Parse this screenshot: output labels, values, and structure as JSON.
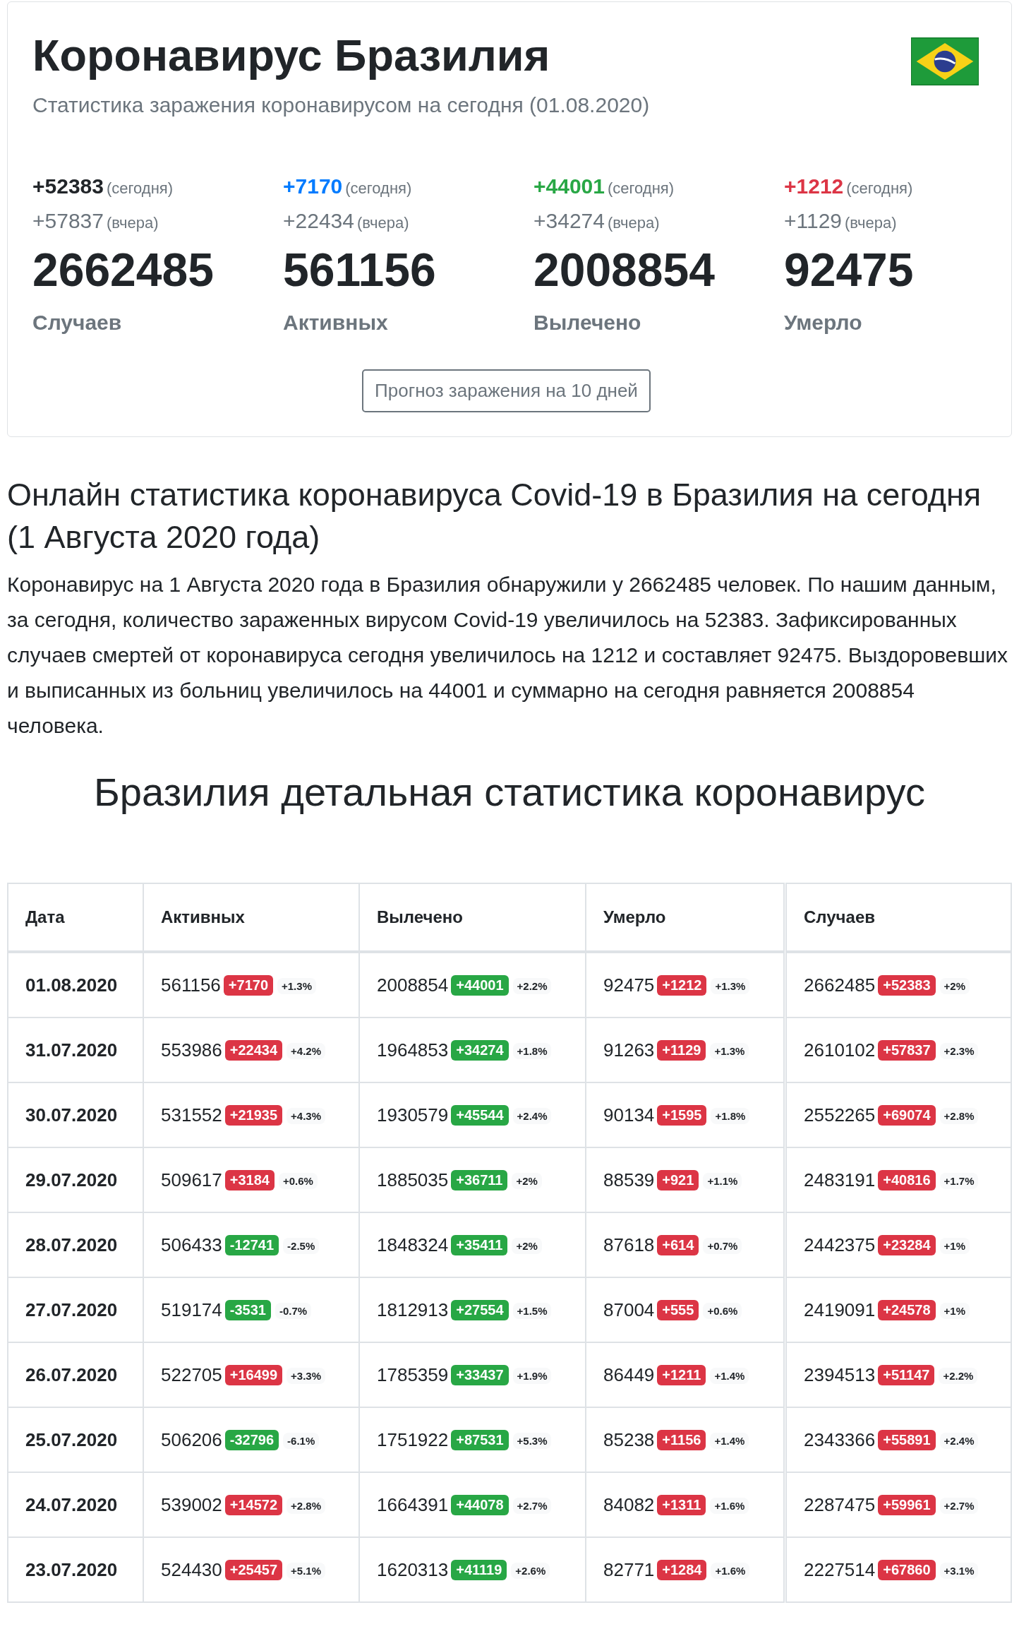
{
  "header": {
    "title": "Коронавирус Бразилия",
    "subtitle": "Статистика заражения коронавирусом на сегодня (01.08.2020)"
  },
  "stats": [
    {
      "today": "+52383",
      "today_label": "(сегодня)",
      "color": "#212529",
      "yesterday": "+57837",
      "yesterday_label": "(вчера)",
      "total": "2662485",
      "label": "Случаев"
    },
    {
      "today": "+7170",
      "today_label": "(сегодня)",
      "color": "#007bff",
      "yesterday": "+22434",
      "yesterday_label": "(вчера)",
      "total": "561156",
      "label": "Активных"
    },
    {
      "today": "+44001",
      "today_label": "(сегодня)",
      "color": "#28a745",
      "yesterday": "+34274",
      "yesterday_label": "(вчера)",
      "total": "2008854",
      "label": "Вылечено"
    },
    {
      "today": "+1212",
      "today_label": "(сегодня)",
      "color": "#dc3545",
      "yesterday": "+1129",
      "yesterday_label": "(вчера)",
      "total": "92475",
      "label": "Умерло"
    }
  ],
  "forecast_button": "Прогноз заражения на 10 дней",
  "article": {
    "heading": "Онлайн статистика коронавируса Covid-19 в Бразилия на сегодня (1 Августа 2020 года)",
    "paragraph": "Коронавирус на 1 Августа 2020 года в Бразилия обнаружили у 2662485 человек. По нашим данным, за сегодня, количество зараженных вирусом Covid-19 увеличилось на 52383. Зафиксированных случаев смертей от коронавируса сегодня увеличилось на 1212 и составляет 92475. Выздоровевших и выписанных из больниц увеличилось на 44001 и суммарно на сегодня равняется 2008854 человека."
  },
  "detail_heading": "Бразилия детальная статистика коронавирус",
  "table": {
    "columns": [
      "Дата",
      "Активных",
      "Вылечено",
      "Умерло",
      "Случаев"
    ],
    "rows": [
      {
        "cells": [
          {
            "kind": "date",
            "value": "01.08.2020"
          },
          {
            "kind": "stat",
            "value": "561156",
            "change": "+7170",
            "color": "#dc3545",
            "pct": "+1.3%"
          },
          {
            "kind": "stat",
            "value": "2008854",
            "change": "+44001",
            "color": "#28a745",
            "pct": "+2.2%"
          },
          {
            "kind": "stat",
            "value": "92475",
            "change": "+1212",
            "color": "#dc3545",
            "pct": "+1.3%"
          },
          {
            "kind": "stat",
            "value": "2662485",
            "change": "+52383",
            "color": "#dc3545",
            "pct": "+2%"
          }
        ]
      },
      {
        "cells": [
          {
            "kind": "date",
            "value": "31.07.2020"
          },
          {
            "kind": "stat",
            "value": "553986",
            "change": "+22434",
            "color": "#dc3545",
            "pct": "+4.2%"
          },
          {
            "kind": "stat",
            "value": "1964853",
            "change": "+34274",
            "color": "#28a745",
            "pct": "+1.8%"
          },
          {
            "kind": "stat",
            "value": "91263",
            "change": "+1129",
            "color": "#dc3545",
            "pct": "+1.3%"
          },
          {
            "kind": "stat",
            "value": "2610102",
            "change": "+57837",
            "color": "#dc3545",
            "pct": "+2.3%"
          }
        ]
      },
      {
        "cells": [
          {
            "kind": "date",
            "value": "30.07.2020"
          },
          {
            "kind": "stat",
            "value": "531552",
            "change": "+21935",
            "color": "#dc3545",
            "pct": "+4.3%"
          },
          {
            "kind": "stat",
            "value": "1930579",
            "change": "+45544",
            "color": "#28a745",
            "pct": "+2.4%"
          },
          {
            "kind": "stat",
            "value": "90134",
            "change": "+1595",
            "color": "#dc3545",
            "pct": "+1.8%"
          },
          {
            "kind": "stat",
            "value": "2552265",
            "change": "+69074",
            "color": "#dc3545",
            "pct": "+2.8%"
          }
        ]
      },
      {
        "cells": [
          {
            "kind": "date",
            "value": "29.07.2020"
          },
          {
            "kind": "stat",
            "value": "509617",
            "change": "+3184",
            "color": "#dc3545",
            "pct": "+0.6%"
          },
          {
            "kind": "stat",
            "value": "1885035",
            "change": "+36711",
            "color": "#28a745",
            "pct": "+2%"
          },
          {
            "kind": "stat",
            "value": "88539",
            "change": "+921",
            "color": "#dc3545",
            "pct": "+1.1%"
          },
          {
            "kind": "stat",
            "value": "2483191",
            "change": "+40816",
            "color": "#dc3545",
            "pct": "+1.7%"
          }
        ]
      },
      {
        "cells": [
          {
            "kind": "date",
            "value": "28.07.2020"
          },
          {
            "kind": "stat",
            "value": "506433",
            "change": "-12741",
            "color": "#28a745",
            "pct": "-2.5%"
          },
          {
            "kind": "stat",
            "value": "1848324",
            "change": "+35411",
            "color": "#28a745",
            "pct": "+2%"
          },
          {
            "kind": "stat",
            "value": "87618",
            "change": "+614",
            "color": "#dc3545",
            "pct": "+0.7%"
          },
          {
            "kind": "stat",
            "value": "2442375",
            "change": "+23284",
            "color": "#dc3545",
            "pct": "+1%"
          }
        ]
      },
      {
        "cells": [
          {
            "kind": "date",
            "value": "27.07.2020"
          },
          {
            "kind": "stat",
            "value": "519174",
            "change": "-3531",
            "color": "#28a745",
            "pct": "-0.7%"
          },
          {
            "kind": "stat",
            "value": "1812913",
            "change": "+27554",
            "color": "#28a745",
            "pct": "+1.5%"
          },
          {
            "kind": "stat",
            "value": "87004",
            "change": "+555",
            "color": "#dc3545",
            "pct": "+0.6%"
          },
          {
            "kind": "stat",
            "value": "2419091",
            "change": "+24578",
            "color": "#dc3545",
            "pct": "+1%"
          }
        ]
      },
      {
        "cells": [
          {
            "kind": "date",
            "value": "26.07.2020"
          },
          {
            "kind": "stat",
            "value": "522705",
            "change": "+16499",
            "color": "#dc3545",
            "pct": "+3.3%"
          },
          {
            "kind": "stat",
            "value": "1785359",
            "change": "+33437",
            "color": "#28a745",
            "pct": "+1.9%"
          },
          {
            "kind": "stat",
            "value": "86449",
            "change": "+1211",
            "color": "#dc3545",
            "pct": "+1.4%"
          },
          {
            "kind": "stat",
            "value": "2394513",
            "change": "+51147",
            "color": "#dc3545",
            "pct": "+2.2%"
          }
        ]
      },
      {
        "cells": [
          {
            "kind": "date",
            "value": "25.07.2020"
          },
          {
            "kind": "stat",
            "value": "506206",
            "change": "-32796",
            "color": "#28a745",
            "pct": "-6.1%"
          },
          {
            "kind": "stat",
            "value": "1751922",
            "change": "+87531",
            "color": "#28a745",
            "pct": "+5.3%"
          },
          {
            "kind": "stat",
            "value": "85238",
            "change": "+1156",
            "color": "#dc3545",
            "pct": "+1.4%"
          },
          {
            "kind": "stat",
            "value": "2343366",
            "change": "+55891",
            "color": "#dc3545",
            "pct": "+2.4%"
          }
        ]
      },
      {
        "cells": [
          {
            "kind": "date",
            "value": "24.07.2020"
          },
          {
            "kind": "stat",
            "value": "539002",
            "change": "+14572",
            "color": "#dc3545",
            "pct": "+2.8%"
          },
          {
            "kind": "stat",
            "value": "1664391",
            "change": "+44078",
            "color": "#28a745",
            "pct": "+2.7%"
          },
          {
            "kind": "stat",
            "value": "84082",
            "change": "+1311",
            "color": "#dc3545",
            "pct": "+1.6%"
          },
          {
            "kind": "stat",
            "value": "2287475",
            "change": "+59961",
            "color": "#dc3545",
            "pct": "+2.7%"
          }
        ]
      },
      {
        "cells": [
          {
            "kind": "date",
            "value": "23.07.2020"
          },
          {
            "kind": "stat",
            "value": "524430",
            "change": "+25457",
            "color": "#dc3545",
            "pct": "+5.1%"
          },
          {
            "kind": "stat",
            "value": "1620313",
            "change": "+41119",
            "color": "#28a745",
            "pct": "+2.6%"
          },
          {
            "kind": "stat",
            "value": "82771",
            "change": "+1284",
            "color": "#dc3545",
            "pct": "+1.6%"
          },
          {
            "kind": "stat",
            "value": "2227514",
            "change": "+67860",
            "color": "#dc3545",
            "pct": "+3.1%"
          }
        ]
      }
    ]
  }
}
